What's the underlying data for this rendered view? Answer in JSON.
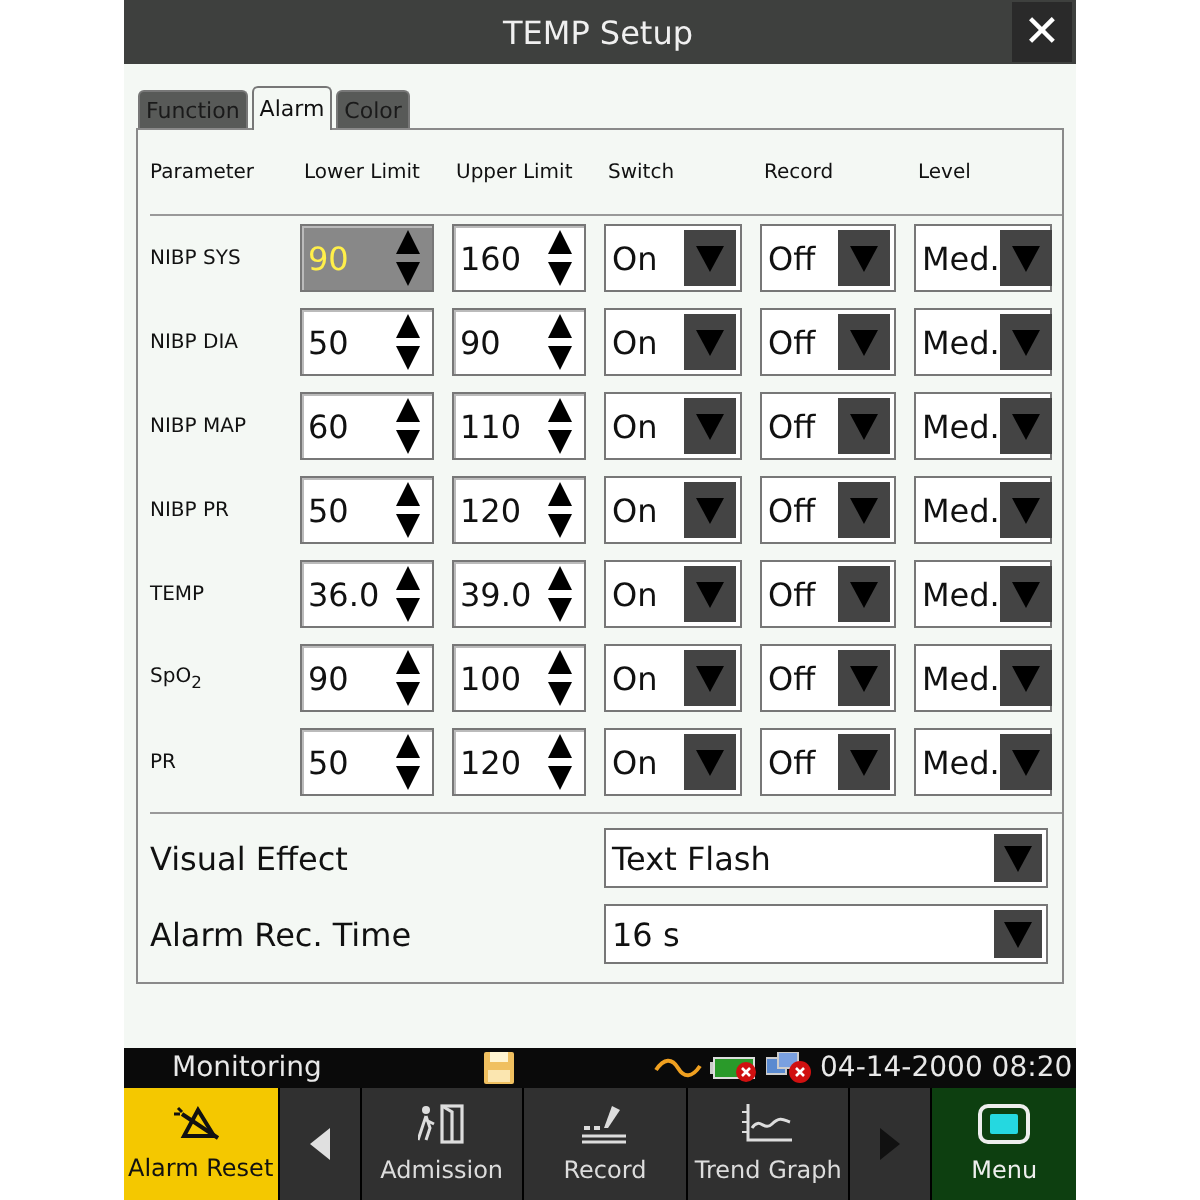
{
  "window": {
    "title": "TEMP Setup",
    "close_label": "✕"
  },
  "tabs": [
    {
      "label": "Function",
      "selected": false
    },
    {
      "label": "Alarm",
      "selected": true
    },
    {
      "label": "Color",
      "selected": false
    }
  ],
  "columns": [
    "Parameter",
    "Lower Limit",
    "Upper Limit",
    "Switch",
    "Record",
    "Level"
  ],
  "rows": [
    {
      "parameter": "NIBP SYS",
      "lower": {
        "value": "90",
        "focused": true
      },
      "upper": {
        "value": "160",
        "focused": false
      },
      "switch": "On",
      "record": "Off",
      "level": "Med."
    },
    {
      "parameter": "NIBP DIA",
      "lower": {
        "value": "50",
        "focused": false
      },
      "upper": {
        "value": "90",
        "focused": false
      },
      "switch": "On",
      "record": "Off",
      "level": "Med."
    },
    {
      "parameter": "NIBP MAP",
      "lower": {
        "value": "60",
        "focused": false
      },
      "upper": {
        "value": "110",
        "focused": false
      },
      "switch": "On",
      "record": "Off",
      "level": "Med."
    },
    {
      "parameter": "NIBP PR",
      "lower": {
        "value": "50",
        "focused": false
      },
      "upper": {
        "value": "120",
        "focused": false
      },
      "switch": "On",
      "record": "Off",
      "level": "Med."
    },
    {
      "parameter": "TEMP",
      "lower": {
        "value": "36.0",
        "focused": false
      },
      "upper": {
        "value": "39.0",
        "focused": false
      },
      "switch": "On",
      "record": "Off",
      "level": "Med."
    },
    {
      "parameter": "SpO$_{2}$",
      "lower": {
        "value": "90",
        "focused": false
      },
      "upper": {
        "value": "100",
        "focused": false
      },
      "switch": "On",
      "record": "Off",
      "level": "Med."
    },
    {
      "parameter": "PR",
      "lower": {
        "value": "50",
        "focused": false
      },
      "upper": {
        "value": "120",
        "focused": false
      },
      "switch": "On",
      "record": "Off",
      "level": "Med."
    }
  ],
  "settings": [
    {
      "label": "Visual Effect",
      "value": "Text Flash"
    },
    {
      "label": "Alarm Rec. Time",
      "value": "16 s"
    }
  ],
  "status_bar": {
    "mode": "Monitoring",
    "datetime": "04-14-2000 08:20"
  },
  "softkeys": [
    {
      "kind": "alarm-reset",
      "label": "Alarm Reset"
    },
    {
      "kind": "prev"
    },
    {
      "kind": "admission",
      "label": "Admission"
    },
    {
      "kind": "record",
      "label": "Record"
    },
    {
      "kind": "trend",
      "label": "Trend Graph"
    },
    {
      "kind": "next"
    },
    {
      "kind": "menu",
      "label": "Menu"
    }
  ]
}
